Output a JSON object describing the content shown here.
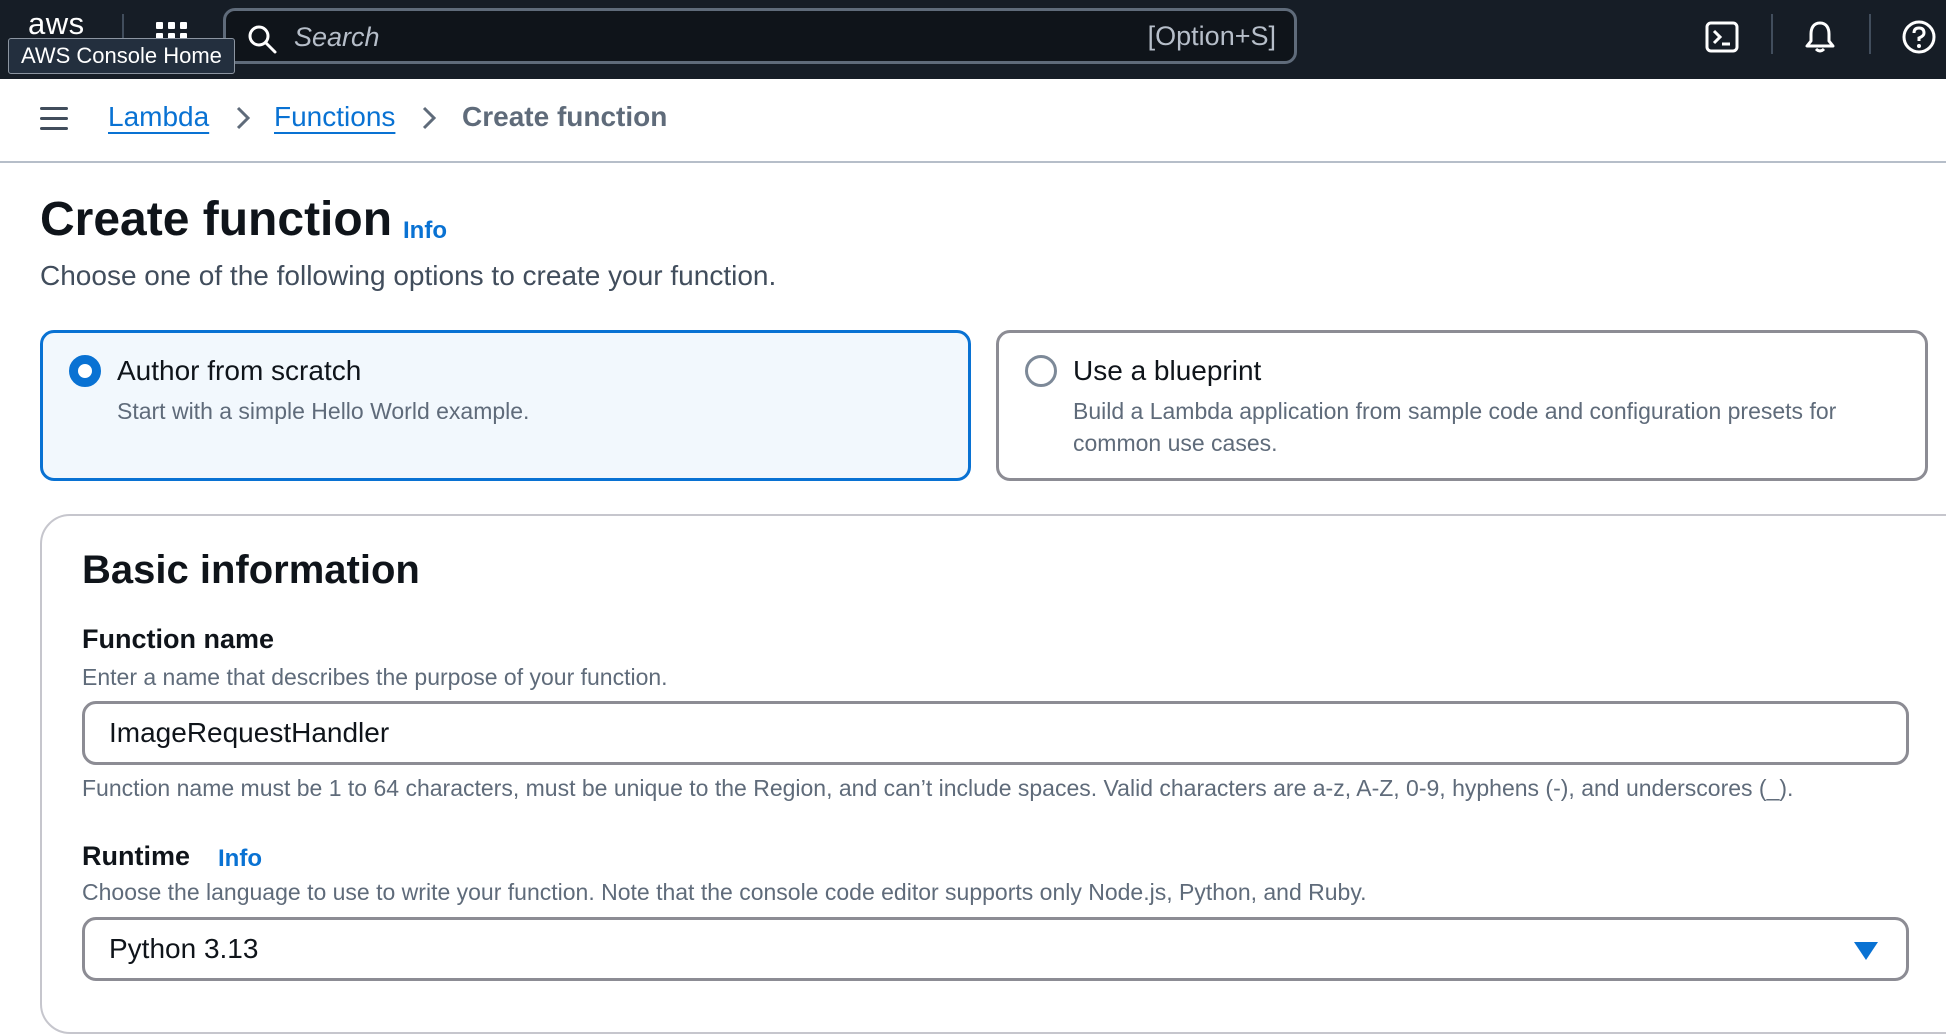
{
  "topnav": {
    "logo_text": "aws",
    "tooltip": "AWS Console Home",
    "search_placeholder": "Search",
    "search_shortcut": "[Option+S]"
  },
  "breadcrumb": {
    "items": [
      "Lambda",
      "Functions"
    ],
    "current": "Create function"
  },
  "page": {
    "title": "Create function",
    "info": "Info",
    "description": "Choose one of the following options to create your function."
  },
  "options": [
    {
      "title": "Author from scratch",
      "description": "Start with a simple Hello World example.",
      "selected": true
    },
    {
      "title": "Use a blueprint",
      "description": "Build a Lambda application from sample code and configuration presets for common use cases.",
      "selected": false
    }
  ],
  "basic_info": {
    "title": "Basic information",
    "function_name": {
      "label": "Function name",
      "description": "Enter a name that describes the purpose of your function.",
      "value": "ImageRequestHandler",
      "constraint": "Function name must be 1 to 64 characters, must be unique to the Region, and can’t include spaces. Valid characters are a-z, A-Z, 0-9, hyphens (-), and underscores (_)."
    },
    "runtime": {
      "label": "Runtime",
      "info": "Info",
      "description": "Choose the language to use to write your function. Note that the console code editor supports only Node.js, Python, and Ruby.",
      "value": "Python 3.13"
    }
  },
  "colors": {
    "nav_bg": "#161d26",
    "link": "#0972d3",
    "selected_card_bg": "#f2f8fd"
  },
  "icons": [
    "grid-icon",
    "search-icon",
    "cloudshell-icon",
    "bell-icon",
    "help-icon",
    "hamburger-icon",
    "chevron-right-icon",
    "caret-down-icon"
  ]
}
